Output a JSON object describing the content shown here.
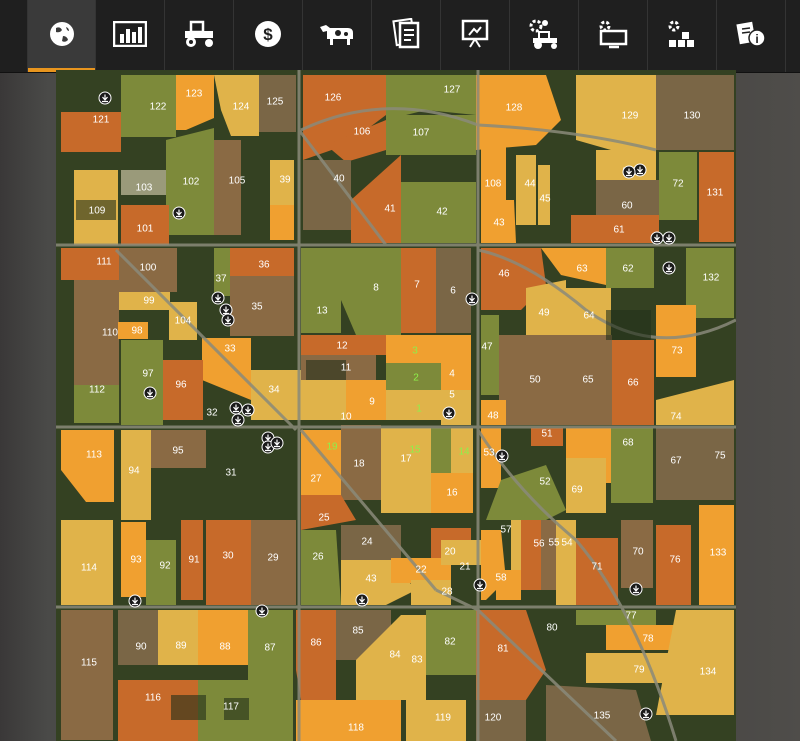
{
  "toolbar": {
    "tabs": [
      {
        "name": "map",
        "icon": "globe-icon",
        "active": true
      },
      {
        "name": "prices",
        "icon": "chart-icon",
        "active": false
      },
      {
        "name": "vehicles",
        "icon": "tractor-icon",
        "active": false
      },
      {
        "name": "finances",
        "icon": "dollar-icon",
        "active": false
      },
      {
        "name": "animals",
        "icon": "cow-icon",
        "active": false
      },
      {
        "name": "contracts",
        "icon": "contracts-icon",
        "active": false
      },
      {
        "name": "help",
        "icon": "presentation-icon",
        "active": false
      },
      {
        "name": "production",
        "icon": "gear-tractor-icon",
        "active": false
      },
      {
        "name": "settings",
        "icon": "monitor-gear-icon",
        "active": false
      },
      {
        "name": "general-settings",
        "icon": "gear-blocks-icon",
        "active": false
      },
      {
        "name": "info",
        "icon": "info-icon",
        "active": false
      }
    ],
    "accent_color": "#e8951e"
  },
  "map": {
    "fields": [
      "121",
      "122",
      "123",
      "124",
      "125",
      "126",
      "127",
      "128",
      "129",
      "130",
      "106",
      "107",
      "103",
      "102",
      "105",
      "39",
      "40",
      "108",
      "44",
      "45",
      "59",
      "72",
      "131",
      "109",
      "101",
      "41",
      "42",
      "43",
      "60",
      "61",
      "111",
      "100",
      "37",
      "36",
      "46",
      "63",
      "62",
      "132",
      "99",
      "35",
      "13",
      "8",
      "7",
      "6",
      "49",
      "64",
      "110",
      "98",
      "104",
      "33",
      "12",
      "3",
      "73",
      "97",
      "96",
      "11",
      "4",
      "47",
      "50",
      "65",
      "66",
      "112",
      "34",
      "9",
      "2",
      "5",
      "32",
      "10",
      "1",
      "48",
      "74",
      "113",
      "95",
      "19",
      "15",
      "14",
      "53",
      "51",
      "68",
      "67",
      "75",
      "94",
      "31",
      "18",
      "17",
      "16",
      "52",
      "69",
      "27",
      "25",
      "24",
      "57",
      "56",
      "55",
      "54",
      "114",
      "93",
      "92",
      "91",
      "30",
      "29",
      "26",
      "20",
      "21",
      "71",
      "70",
      "76",
      "133",
      "43",
      "22",
      "28",
      "58",
      "80",
      "77",
      "115",
      "90",
      "89",
      "88",
      "87",
      "86",
      "85",
      "84",
      "83",
      "82",
      "81",
      "78",
      "79",
      "134",
      "116",
      "117",
      "118",
      "119",
      "120",
      "135"
    ]
  }
}
